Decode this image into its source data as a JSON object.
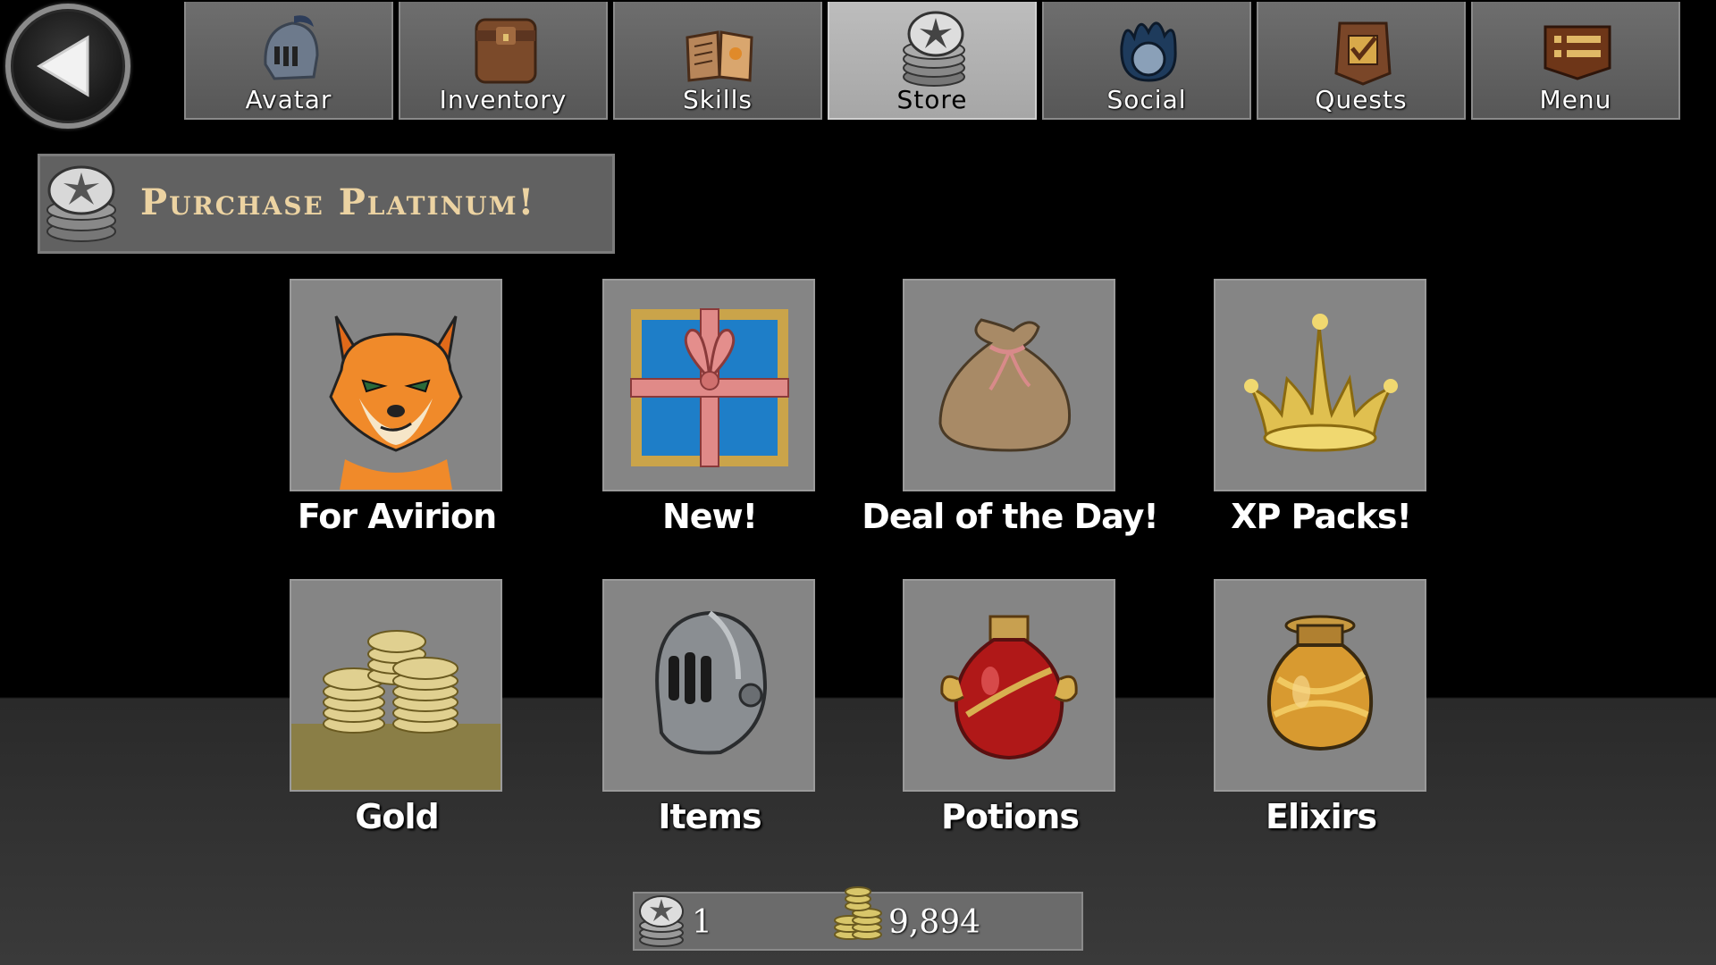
{
  "nav": {
    "back_label": "Back",
    "tabs": [
      {
        "label": "Avatar",
        "icon": "helmet-icon",
        "active": false
      },
      {
        "label": "Inventory",
        "icon": "backpack-icon",
        "active": false
      },
      {
        "label": "Skills",
        "icon": "book-icon",
        "active": false
      },
      {
        "label": "Store",
        "icon": "platinum-coins-icon",
        "active": true
      },
      {
        "label": "Social",
        "icon": "flame-orb-icon",
        "active": false
      },
      {
        "label": "Quests",
        "icon": "quest-scroll-icon",
        "active": false
      },
      {
        "label": "Menu",
        "icon": "menu-list-icon",
        "active": false
      }
    ]
  },
  "banner": {
    "text": "Purchase Platinum!",
    "icon": "platinum-coins-icon"
  },
  "store": {
    "items": [
      {
        "label": "For Avirion",
        "icon": "fox-character-icon"
      },
      {
        "label": "New!",
        "icon": "gift-box-icon"
      },
      {
        "label": "Deal of the Day!",
        "icon": "loot-sack-icon"
      },
      {
        "label": "XP Packs!",
        "icon": "crown-icon"
      },
      {
        "label": "Gold",
        "icon": "gold-coins-icon"
      },
      {
        "label": "Items",
        "icon": "knight-helmet-icon"
      },
      {
        "label": "Potions",
        "icon": "red-potion-icon"
      },
      {
        "label": "Elixirs",
        "icon": "elixir-jar-icon"
      }
    ]
  },
  "currency": {
    "platinum": "1",
    "gold": "9,894"
  },
  "colors": {
    "background": "#000000",
    "tab": "#616161",
    "tab_active": "#b3b3b3",
    "tile": "#858585",
    "banner_text": "#ecd3a2"
  }
}
